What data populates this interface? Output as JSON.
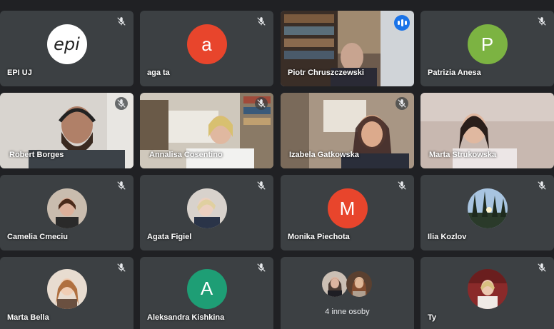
{
  "meeting": {
    "tiles": [
      {
        "name": "EPI UJ",
        "avatar_text": "epi",
        "avatar_color": "#ffffff",
        "muted": true
      },
      {
        "name": "aga ta",
        "avatar_text": "a",
        "avatar_color": "#e8452c",
        "muted": true
      },
      {
        "name": "Piotr Chruszczewski",
        "speaking": true,
        "video": true,
        "muted": false
      },
      {
        "name": "Patrizia Anesa",
        "avatar_text": "P",
        "avatar_color": "#7cb342",
        "muted": true
      },
      {
        "name": "Robert Borges",
        "video": true,
        "muted": true
      },
      {
        "name": "Annalisa Cosentino",
        "video": true,
        "muted": true
      },
      {
        "name": "Izabela Gatkowska",
        "video": true,
        "muted": true
      },
      {
        "name": "Marta Strukowska",
        "video": true,
        "muted": false
      },
      {
        "name": "Camelia Cmeciu",
        "avatar_photo": true,
        "muted": true
      },
      {
        "name": "Agata Figiel",
        "avatar_photo": true,
        "muted": true
      },
      {
        "name": "Monika Piechota",
        "avatar_text": "M",
        "avatar_color": "#e8452c",
        "muted": true
      },
      {
        "name": "Ilia Kozlov",
        "avatar_photo": true,
        "muted": true
      },
      {
        "name": "Marta Bella",
        "avatar_photo": true,
        "muted": true
      },
      {
        "name": "Aleksandra Kishkina",
        "avatar_text": "A",
        "avatar_color": "#1e9e75",
        "muted": true
      },
      {
        "name": "",
        "others_label": "4 inne osoby",
        "muted": false
      },
      {
        "name": "Ty",
        "avatar_photo": true,
        "muted": true
      }
    ]
  },
  "icons": {
    "mic_off": "mic-off-icon",
    "speaking": "speaking-indicator-icon"
  },
  "colors": {
    "background": "#202124",
    "tile": "#3c4043",
    "active_border": "#8ab4f8",
    "speaking": "#1a73e8"
  }
}
